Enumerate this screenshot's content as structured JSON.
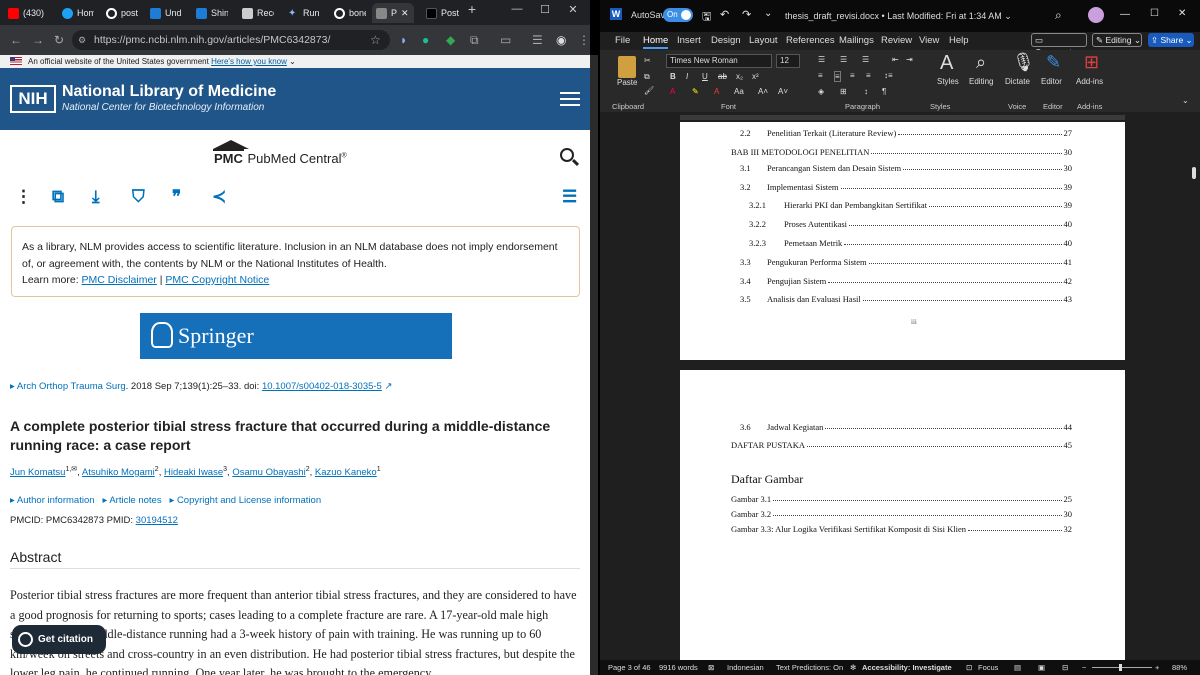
{
  "browser": {
    "tabs": [
      {
        "label": "(430)",
        "color": "#ff0000"
      },
      {
        "label": "Hom",
        "color": "#1da1f2"
      },
      {
        "label": "post",
        "color": "#ffffff"
      },
      {
        "label": "Undi",
        "color": "#1c7cd6"
      },
      {
        "label": "Shin",
        "color": "#1c7cd6"
      },
      {
        "label": "Reco",
        "color": "#ffffff"
      },
      {
        "label": "Runi",
        "color": "#8ab4f8"
      },
      {
        "label": "bone",
        "color": "#ffffff"
      },
      {
        "label": "P",
        "color": "#888888"
      },
      {
        "label": "Post",
        "color": "#000000"
      }
    ],
    "active_tab_close": "✕",
    "new_tab": "+",
    "url": "https://pmc.ncbi.nlm.nih.gov/articles/PMC6342873/",
    "gov_banner": {
      "text": "An official website of the United States government",
      "link": "Here's how you know"
    },
    "nlm": {
      "abbr": "NIH",
      "title": "National Library of Medicine",
      "subtitle": "National Center for Biotechnology Information"
    },
    "pmc_logo": {
      "abbr": "PMC",
      "name": "PubMed Central",
      "reg": "®"
    },
    "notice": {
      "text": "As a library, NLM provides access to scientific literature. Inclusion in an NLM database does not imply endorsement of, or agreement with, the contents by NLM or the National Institutes of Health.",
      "learn_more": "Learn more:",
      "link1": "PMC Disclaimer",
      "sep": "|",
      "link2": "PMC Copyright Notice"
    },
    "publisher": "Springer",
    "citation": {
      "prefix": "▸ Arch Orthop Trauma Surg",
      "text": ". 2018 Sep 7;139(1):25–33. doi: ",
      "doi": "10.1007/s00402-018-3035-5"
    },
    "article_title": "A complete posterior tibial stress fracture that occurred during a middle-distance running race: a case report",
    "authors": [
      {
        "name": "Jun Komatsu",
        "sup": "1,✉"
      },
      {
        "name": "Atsuhiko Mogami",
        "sup": "2"
      },
      {
        "name": "Hideaki Iwase",
        "sup": "3"
      },
      {
        "name": "Osamu Obayashi",
        "sup": "2"
      },
      {
        "name": "Kazuo Kaneko",
        "sup": "1"
      }
    ],
    "article_links": [
      "▸ Author information",
      "▸ Article notes",
      "▸ Copyright and License information"
    ],
    "pmcid": "PMCID: PMC6342873  PMID: ",
    "pmid": "30194512",
    "abstract_title": "Abstract",
    "abstract_text": "Posterior tibial stress fractures are more frequent than anterior tibial stress fractures, and they are considered to have a good prognosis for returning to sports; cases leading to a complete fracture are rare. A 17-year-old male high school athletics middle-distance running had a 3-week history of pain with training. He was running up to 60 km/week on streets and cross-country in an even distribution. He had posterior tibial stress fractures, but despite the lower leg pain, he continued running. One year later, he was brought to the emergency",
    "get_citation": "Get citation"
  },
  "word": {
    "autosave_label": "AutoSave",
    "autosave_state": "On",
    "doc_title": "thesis_draft_revisi.docx • Last Modified: Fri at 1:34 AM ⌄",
    "menus": [
      "File",
      "Home",
      "Insert",
      "Design",
      "Layout",
      "References",
      "Mailings",
      "Review",
      "View",
      "Help"
    ],
    "comments": "Comments",
    "editing": "Editing ⌄",
    "share": "Share ⌄",
    "font_name": "Times New Roman",
    "font_size": "12",
    "groups": [
      "Clipboard",
      "Font",
      "Paragraph",
      "Styles",
      "Voice",
      "Editor",
      "Add-ins"
    ],
    "ribbon_buttons": [
      "Paste",
      "Styles",
      "Editing",
      "Dictate",
      "Editor",
      "Add-ins"
    ],
    "toc_page1": [
      {
        "num": "2.2",
        "text": "Penelitian Terkait (Literature Review)",
        "page": "27",
        "level": 2
      },
      {
        "num": "",
        "text": "BAB III METODOLOGI PENELITIAN",
        "page": "30",
        "level": 1
      },
      {
        "num": "3.1",
        "text": "Perancangan Sistem dan Desain Sistem",
        "page": "30",
        "level": 2
      },
      {
        "num": "3.2",
        "text": "Implementasi Sistem",
        "page": "39",
        "level": 2
      },
      {
        "num": "3.2.1",
        "text": "Hierarki PKI dan Pembangkitan Sertifikat",
        "page": "39",
        "level": 3
      },
      {
        "num": "3.2.2",
        "text": "Proses Autentikasi",
        "page": "40",
        "level": 3
      },
      {
        "num": "3.2.3",
        "text": "Pemetaan Metrik",
        "page": "40",
        "level": 3
      },
      {
        "num": "3.3",
        "text": "Pengukuran Performa Sistem",
        "page": "41",
        "level": 2
      },
      {
        "num": "3.4",
        "text": "Pengujian Sistem",
        "page": "42",
        "level": 2
      },
      {
        "num": "3.5",
        "text": "Analisis dan Evaluasi Hasil",
        "page": "43",
        "level": 2
      }
    ],
    "page1_number": "iii",
    "toc_page2": [
      {
        "num": "3.6",
        "text": "Jadwal Kegiatan",
        "page": "44",
        "level": 2
      },
      {
        "num": "",
        "text": "DAFTAR PUSTAKA",
        "page": "45",
        "level": 1
      }
    ],
    "figures_heading": "Daftar Gambar",
    "figures": [
      {
        "text": "Gambar 3.1",
        "page": "25"
      },
      {
        "text": "Gambar 3.2",
        "page": "30"
      },
      {
        "text": "Gambar 3.3: Alur Logika Verifikasi Sertifikat Komposit di Sisi Klien",
        "page": "32"
      }
    ],
    "status": {
      "page": "Page 3 of 46",
      "words": "9916 words",
      "language": "Indonesian",
      "predictions": "Text Predictions: On",
      "accessibility": "Accessibility: Investigate",
      "focus": "Focus",
      "zoom": "88%"
    }
  }
}
